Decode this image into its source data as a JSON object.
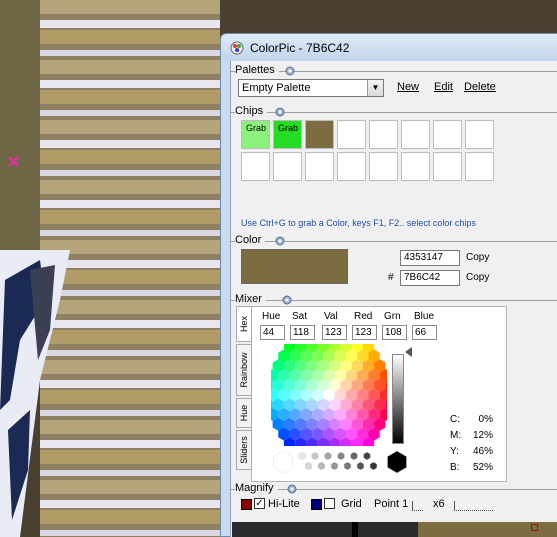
{
  "window": {
    "title": "ColorPic - 7B6C42"
  },
  "palettes": {
    "label": "Palettes",
    "selected": "Empty Palette",
    "new_label": "New",
    "edit_label": "Edit",
    "delete_label": "Delete"
  },
  "chips": {
    "label": "Chips",
    "items": [
      {
        "text": "Grab",
        "color": "#8cf07c"
      },
      {
        "text": "Grab",
        "color": "#22dd22"
      },
      {
        "text": "",
        "color": "#7b6c42"
      }
    ],
    "hint": "Use Ctrl+G to grab a Color, keys F1, F2.. select color chips"
  },
  "color": {
    "label": "Color",
    "swatch": "#7b6c42",
    "decimal": "4353147",
    "hash": "#",
    "hex": "7B6C42",
    "copy_label": "Copy"
  },
  "mixer": {
    "label": "Mixer",
    "tabs": [
      "Hex",
      "Rainbow",
      "Hue",
      "Sliders"
    ],
    "headers": [
      "Hue",
      "Sat",
      "Val",
      "Red",
      "Grn",
      "Blue"
    ],
    "values": [
      "44",
      "118",
      "123",
      "123",
      "108",
      "66"
    ],
    "cmyk": [
      {
        "k": "C:",
        "v": "0%"
      },
      {
        "k": "M:",
        "v": "12%"
      },
      {
        "k": "Y:",
        "v": "46%"
      },
      {
        "k": "B:",
        "v": "52%"
      }
    ]
  },
  "magnify": {
    "label": "Magnify",
    "hilite_label": "Hi-Lite",
    "grid_label": "Grid",
    "point_label": "Point 1",
    "zoom_label": "x6",
    "hilite_color": "#8b0000",
    "grid_color": "#00007f"
  }
}
